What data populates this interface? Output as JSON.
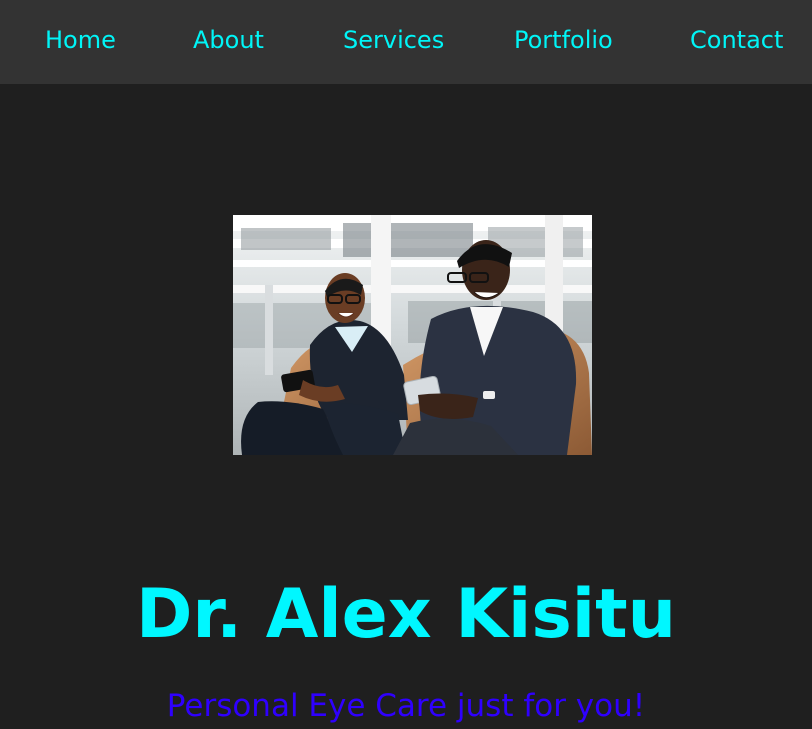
{
  "nav": {
    "items": [
      {
        "label": "Home"
      },
      {
        "label": "About"
      },
      {
        "label": "Services"
      },
      {
        "label": "Portfolio"
      },
      {
        "label": "Contact"
      }
    ]
  },
  "hero": {
    "title": "Dr. Alex Kisitu",
    "subtitle": "Personal Eye Care just for you!"
  },
  "colors": {
    "background": "#1f1f1f",
    "nav_background": "#333333",
    "nav_link": "#00f5f7",
    "title": "#00f7ff",
    "subtitle": "#2f00ff"
  }
}
